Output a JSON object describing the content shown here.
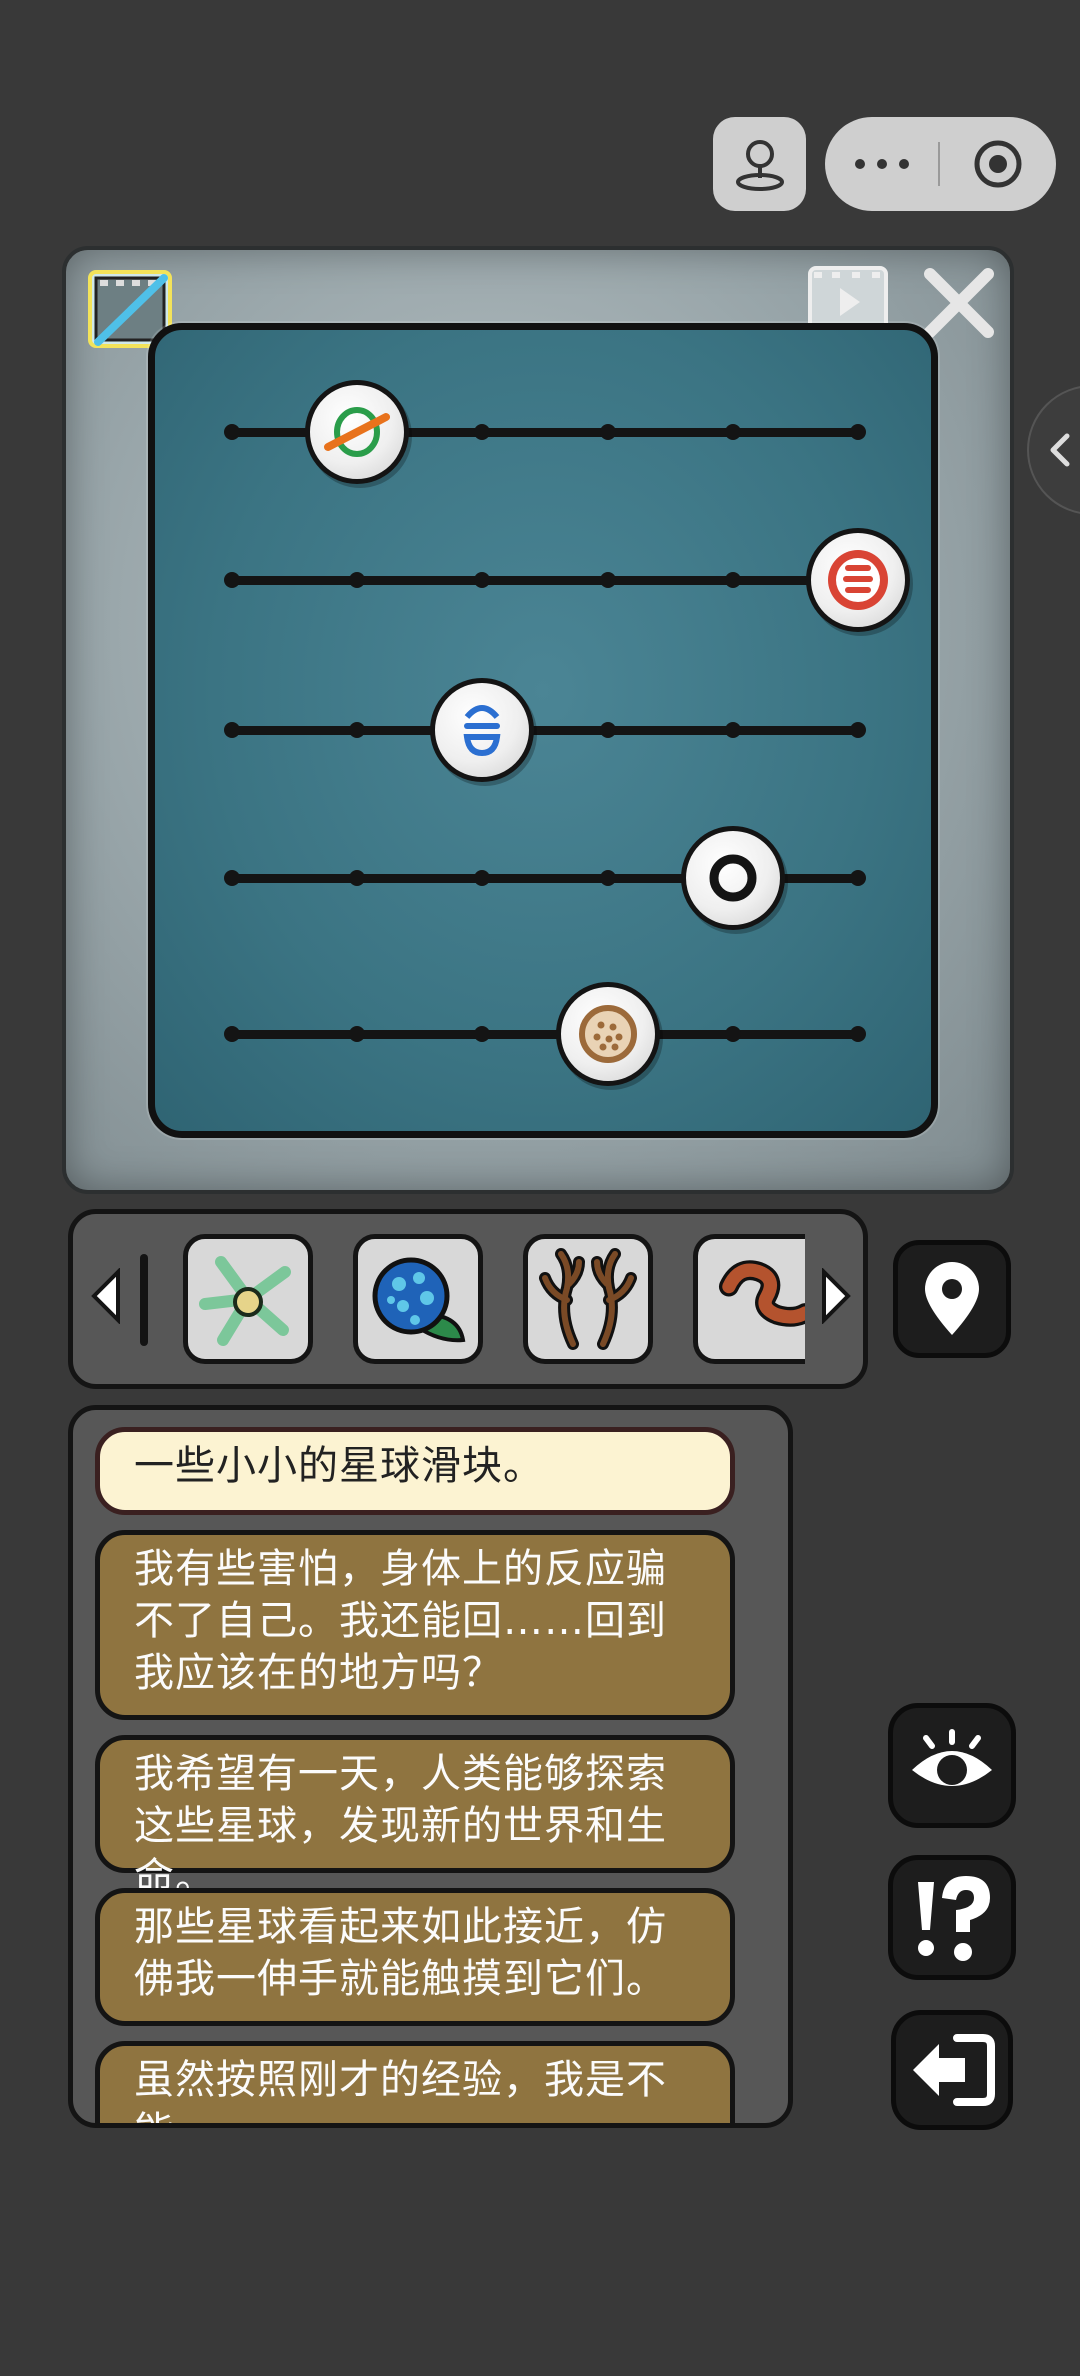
{
  "top_bar": {
    "joystick_icon": "joystick-icon",
    "more_icon": "more-dots-icon",
    "close_app_icon": "target-icon"
  },
  "puzzle": {
    "hint_icon": "crossed-film-icon",
    "video_icon": "video-play-icon",
    "close_icon": "close-icon",
    "rows": [
      {
        "symbol": "planet-ring",
        "position": 1,
        "color": "#e8721c"
      },
      {
        "symbol": "striped-red",
        "position": 5,
        "color": "#d94434"
      },
      {
        "symbol": "blue-stripes",
        "position": 2,
        "color": "#2b6fd1"
      },
      {
        "symbol": "ring",
        "position": 4,
        "color": "#141414"
      },
      {
        "symbol": "dotted-brown",
        "position": 3,
        "color": "#9c6a3a"
      }
    ]
  },
  "inventory": {
    "items": [
      {
        "name": "starfish-item"
      },
      {
        "name": "blue-egg-item"
      },
      {
        "name": "antlers-item"
      },
      {
        "name": "worm-item"
      }
    ],
    "location_icon": "location-pin-icon"
  },
  "dialog": {
    "lines": [
      "一些小小的星球滑块。",
      "我有些害怕，身体上的反应骗不了自己。我还能回……回到我应该在的地方吗？",
      "我希望有一天，人类能够探索这些星球，发现新的世界和生命。",
      "那些星球看起来如此接近，仿佛我一伸手就能触摸到它们。",
      "虽然按照刚才的经验，我是不能"
    ]
  },
  "buttons": {
    "eye": "eye-icon",
    "hint": "hint-icon",
    "exit": "exit-icon"
  }
}
